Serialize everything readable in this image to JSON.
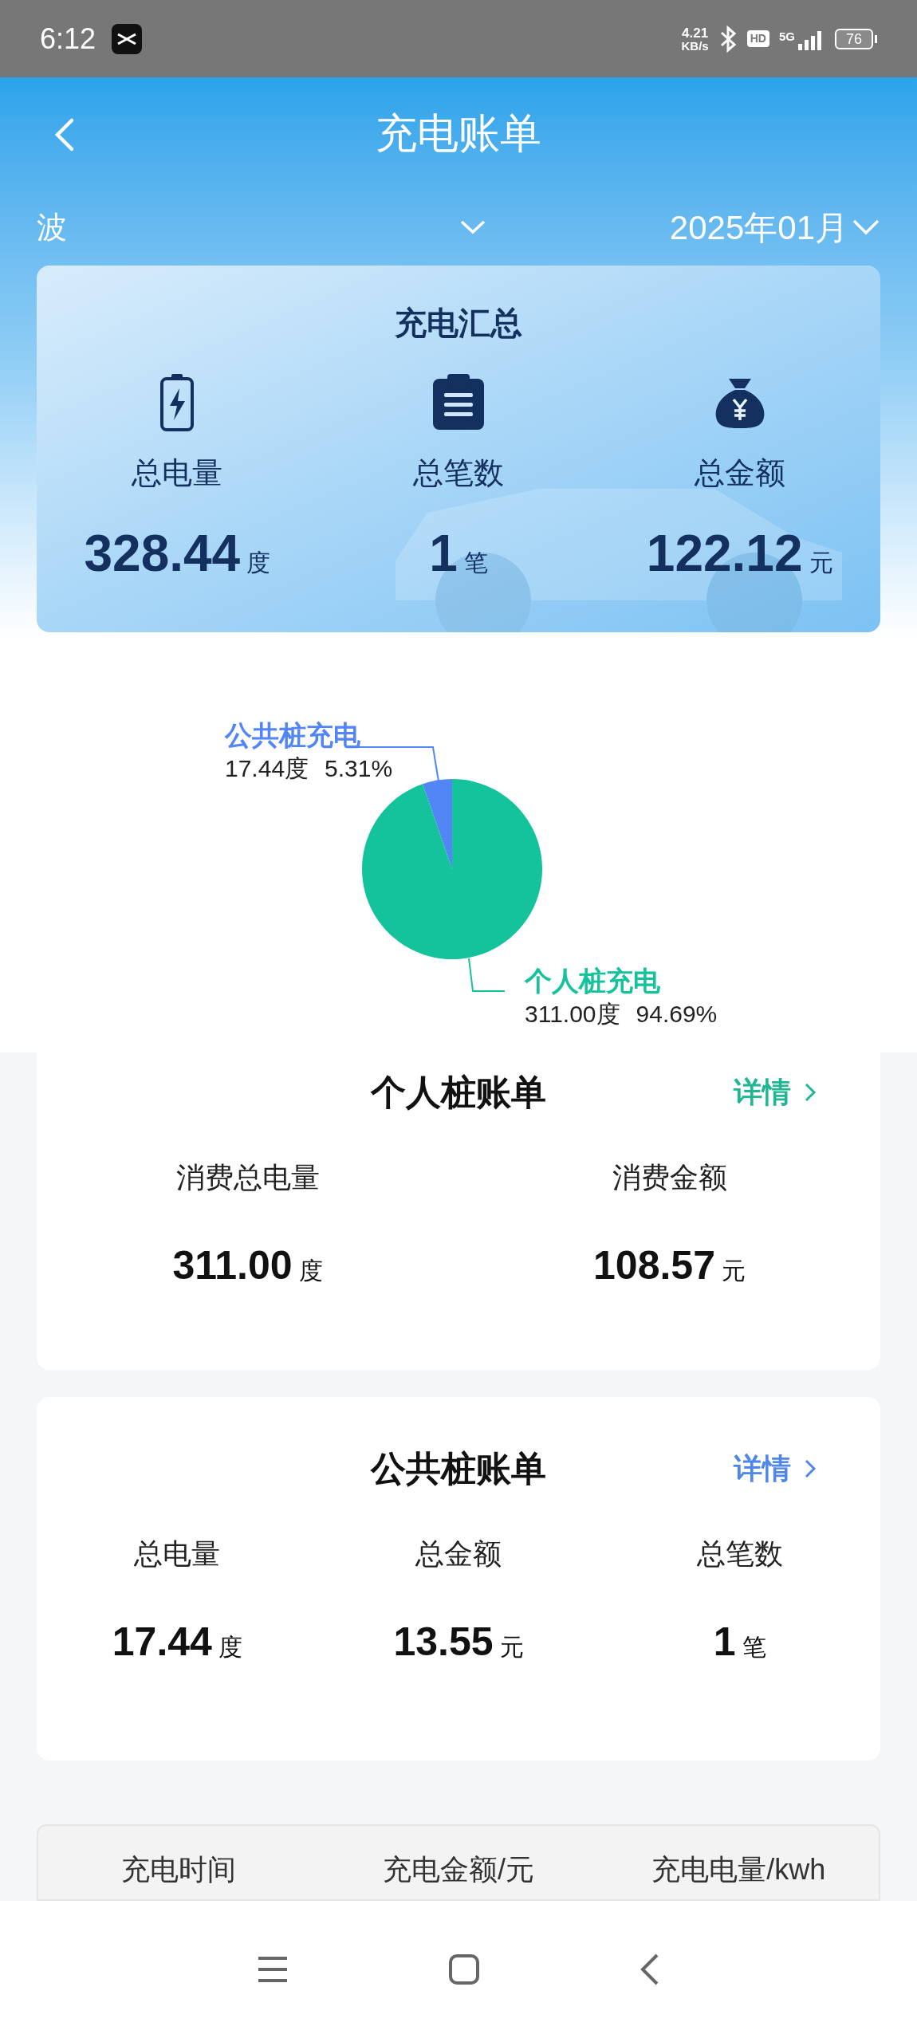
{
  "status_bar": {
    "time": "6:12",
    "net_speed": "4.21",
    "net_unit": "KB/s",
    "hd": "HD",
    "network": "5G",
    "battery": "76"
  },
  "header": {
    "title": "充电账单"
  },
  "filter": {
    "vehicle": "波",
    "month": "2025年01月"
  },
  "summary": {
    "title": "充电汇总",
    "items": [
      {
        "kind": "battery",
        "label": "总电量",
        "value": "328.44",
        "unit": "度"
      },
      {
        "kind": "clipboard",
        "label": "总笔数",
        "value": "1",
        "unit": "笔"
      },
      {
        "kind": "moneybag",
        "label": "总金额",
        "value": "122.12",
        "unit": "元"
      }
    ]
  },
  "breakdown": {
    "chart_data": {
      "type": "pie",
      "categories": [
        "公共桩充电",
        "个人桩充电"
      ],
      "values": [
        5.31,
        94.69
      ]
    },
    "labels": [
      {
        "amount": "17.44度",
        "percent": "5.31%",
        "color": "#5285f5"
      },
      {
        "amount": "311.00度",
        "percent": "94.69%",
        "color": "#14c29b"
      }
    ]
  },
  "bills": [
    {
      "title": "个人桩账单",
      "link": "详情",
      "color": "#1fb793",
      "items": [
        {
          "label": "消费总电量",
          "value": "311.00",
          "unit": "度"
        },
        {
          "label": "消费金额",
          "value": "108.57",
          "unit": "元"
        }
      ]
    },
    {
      "title": "公共桩账单",
      "link": "详情",
      "color": "#4f86ea",
      "items": [
        {
          "label": "总电量",
          "value": "17.44",
          "unit": "度"
        },
        {
          "label": "总金额",
          "value": "13.55",
          "unit": "元"
        },
        {
          "label": "总笔数",
          "value": "1",
          "unit": "笔"
        }
      ]
    }
  ],
  "table": {
    "columns": [
      "充电时间",
      "充电金额/元",
      "充电电量/kwh"
    ]
  }
}
